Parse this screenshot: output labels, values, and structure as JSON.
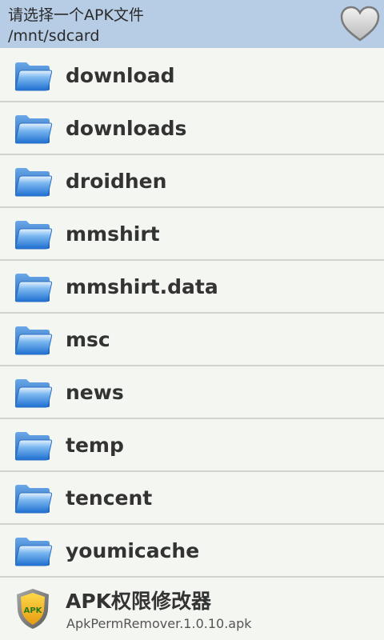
{
  "header": {
    "title": "请选择一个APK文件",
    "path": "/mnt/sdcard",
    "favorite_icon": "heart-icon"
  },
  "folders": [
    {
      "name": "download",
      "icon": "folder-icon"
    },
    {
      "name": "downloads",
      "icon": "folder-icon"
    },
    {
      "name": "droidhen",
      "icon": "folder-icon"
    },
    {
      "name": "mmshirt",
      "icon": "folder-icon"
    },
    {
      "name": "mmshirt.data",
      "icon": "folder-icon"
    },
    {
      "name": "msc",
      "icon": "folder-icon"
    },
    {
      "name": "news",
      "icon": "folder-icon"
    },
    {
      "name": "temp",
      "icon": "folder-icon"
    },
    {
      "name": "tencent",
      "icon": "folder-icon"
    },
    {
      "name": "youmicache",
      "icon": "folder-icon"
    }
  ],
  "apk_file": {
    "app_name": "APK权限修改器",
    "file_name": "ApkPermRemover.1.0.10.apk",
    "icon": "apk-shield-icon",
    "icon_text": "APK"
  },
  "colors": {
    "header_bg": "#b7cde6",
    "list_bg": "#f4f6f1",
    "divider": "#cfd4cd",
    "folder_blue": "#2a7fd8"
  }
}
